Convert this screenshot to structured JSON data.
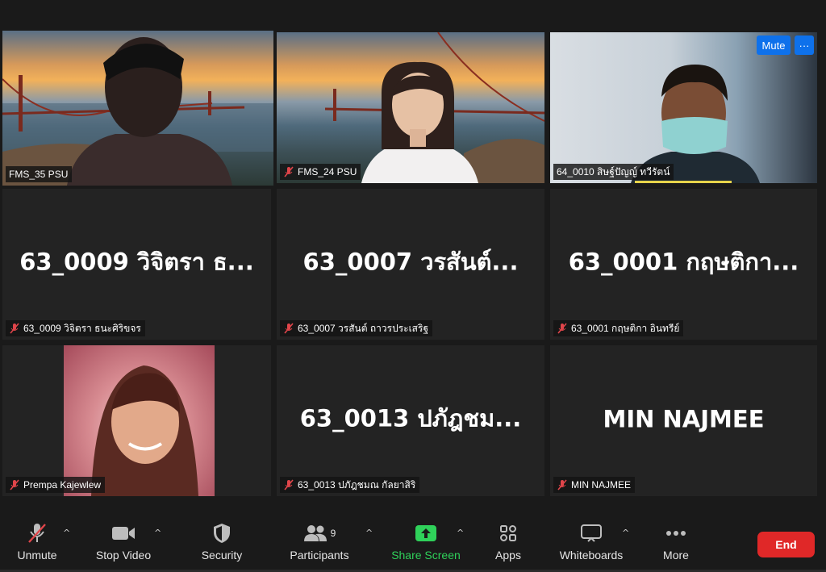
{
  "tiles": {
    "t1": {
      "name": "FMS_35 PSU"
    },
    "t2": {
      "name": "FMS_24 PSU"
    },
    "t3": {
      "name": "64_0010 สิษฐ์ปัญญ์ ทวีรัตน์",
      "mute_label": "Mute",
      "more_label": "···"
    },
    "t4": {
      "display": "63_0009 วิจิตรา ธ...",
      "name": "63_0009 วิจิตรา ธนะศิริขจร"
    },
    "t5": {
      "display": "63_0007 วรสันต์...",
      "name": "63_0007 วรสันต์ ถาวรประเสริฐ"
    },
    "t6": {
      "display": "63_0001 กฤษติกา...",
      "name": "63_0001 กฤษติกา อินทรีย์"
    },
    "t7": {
      "name": "Prempa Kajewlew"
    },
    "t8": {
      "display": "63_0013 ปภัฎชม...",
      "name": "63_0013 ปภัฎชมณ กัลยาสิริ"
    },
    "t9": {
      "display": "MIN NAJMEE",
      "name": "MIN NAJMEE"
    }
  },
  "toolbar": {
    "unmute": "Unmute",
    "stop_video": "Stop Video",
    "security": "Security",
    "participants": "Participants",
    "participants_count": "9",
    "share_screen": "Share Screen",
    "apps": "Apps",
    "whiteboards": "Whiteboards",
    "more": "More",
    "end": "End"
  },
  "colors": {
    "active_speaker": "#c6e36a",
    "share_green": "#2fd15a",
    "end_red": "#e02828",
    "mute_blue": "#0e71eb",
    "muted_mic_red": "#e0454a"
  },
  "icons": [
    "mic-muted-icon",
    "video-camera-icon",
    "shield-icon",
    "participants-icon",
    "share-screen-icon",
    "apps-icon",
    "whiteboard-icon",
    "more-dots-icon"
  ]
}
